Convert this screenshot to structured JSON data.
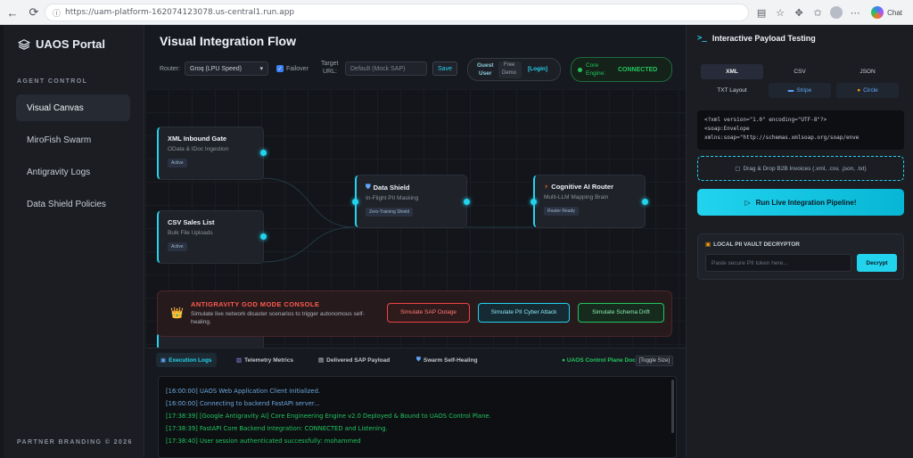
{
  "browser": {
    "url": "https://uam-platform-162074123078.us-central1.run.app",
    "chat_label": "Chat"
  },
  "sidebar": {
    "logo_text": "UAOS Portal",
    "section_label": "AGENT CONTROL",
    "items": [
      {
        "label": "Visual Canvas",
        "active": true
      },
      {
        "label": "MiroFish Swarm",
        "active": false
      },
      {
        "label": "Antigravity Logs",
        "active": false
      },
      {
        "label": "Data Shield Policies",
        "active": false
      }
    ],
    "footer": "PARTNER BRANDING © 2026"
  },
  "main": {
    "title": "Visual Integration Flow",
    "toolbar": {
      "router_label": "Router:",
      "router_value": "Groq (LPU Speed)",
      "failover_label": "Failover",
      "target_label_1": "Target",
      "target_label_2": "URL:",
      "target_value": "Default (Mock SAP)",
      "save_label": "Save",
      "user_line1": "Guest",
      "user_line2": "User",
      "tier_line1": "Free",
      "tier_line2": "Demo",
      "login_label": "[Login]",
      "core_label_1": "Core",
      "core_label_2": "Engine:",
      "core_status": "CONNECTED"
    },
    "nodes": [
      {
        "title": "XML Inbound Gate",
        "subtitle": "OData & IDoc Ingestion",
        "badge": "Active"
      },
      {
        "title": "CSV Sales List",
        "subtitle": "Bulk File Uploads",
        "badge": "Active"
      },
      {
        "title": "Data Shield",
        "subtitle": "In-Flight PII Masking",
        "badge": "Zero-Training Shield"
      },
      {
        "title": "Cognitive AI Router",
        "subtitle": "Multi-LLM Mapping Brain",
        "badge": "Router Ready"
      }
    ],
    "console": {
      "title": "ANTIGRAVITY GOD MODE CONSOLE",
      "description": "Simulate live network disaster scenarios to trigger autonomous self-healing.",
      "buttons": [
        {
          "label": "Simulate SAP Outage",
          "color": "#ef4444"
        },
        {
          "label": "Simulate PII Cyber Attack",
          "color": "#22d3ee"
        },
        {
          "label": "Simulate Schema Drift",
          "color": "#22c55e"
        }
      ]
    },
    "tabs": [
      {
        "label": "Execution Logs",
        "active": true
      },
      {
        "label": "Telemetry Metrics",
        "active": false
      },
      {
        "label": "Delivered SAP Payload",
        "active": false
      },
      {
        "label": "Swarm Self-Healing",
        "active": false
      }
    ],
    "docked_label": "● UAOS Control Plane Docked",
    "toggle_label": "[Toggle Size]",
    "logs": [
      {
        "text": "[16:00:00] UAOS Web Application Client initialized.",
        "color": "#6fa8dc"
      },
      {
        "text": "[16:00:00] Connecting to backend FastAPI server...",
        "color": "#6fa8dc"
      },
      {
        "text": "[17:38:39] [Google Antigravity AI] Core Engineering Engine v2.0 Deployed & Bound to UAOS Control Plane.",
        "color": "#22c55e"
      },
      {
        "text": "[17:38:39] FastAPI Core Backend Integration: CONNECTED and Listening.",
        "color": "#22c55e"
      },
      {
        "text": "[17:38:40] User session authenticated successfully: mohammed",
        "color": "#22c55e"
      }
    ]
  },
  "right_panel": {
    "title": "Interactive Payload Testing",
    "formats": [
      {
        "label": "XML",
        "active": true
      },
      {
        "label": "CSV",
        "active": false
      },
      {
        "label": "JSON",
        "active": false
      },
      {
        "label": "TXT Layout",
        "active": false
      },
      {
        "label": "Stripe",
        "active": false
      },
      {
        "label": "Circle",
        "active": false
      }
    ],
    "code_lines": [
      "<?xml version=\"1.0\" encoding=\"UTF-8\"?>",
      "<soap:Envelope",
      "xmlns:soap=\"http://schemas.xmlsoap.org/soap/enve"
    ],
    "dropzone_label": "Drag & Drop B2B Invoices (.xml, .csv, .json, .txt)",
    "run_label": "Run Live Integration Pipeline!",
    "vault_title": "LOCAL PII VAULT DECRYPTOR",
    "vault_placeholder": "Paste secure PII token here...",
    "decrypt_label": "Decrypt"
  }
}
